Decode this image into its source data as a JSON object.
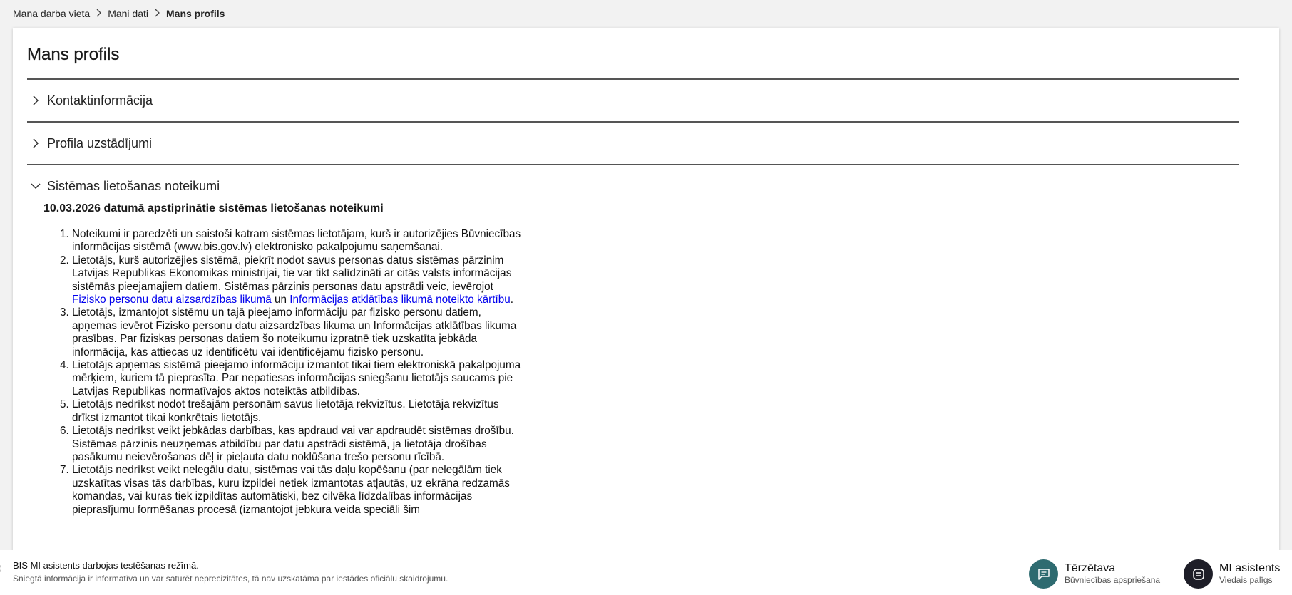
{
  "breadcrumb": {
    "items": [
      "Mana darba vieta",
      "Mani dati"
    ],
    "current": "Mans profils"
  },
  "page": {
    "title": "Mans profils"
  },
  "sections": [
    {
      "label": "Kontaktinformācija",
      "expanded": false
    },
    {
      "label": "Profila uzstādījumi",
      "expanded": false
    },
    {
      "label": "Sistēmas lietošanas noteikumi",
      "expanded": true
    }
  ],
  "terms": {
    "title": "10.03.2026 datumā apstiprinātie sistēmas lietošanas noteikumi",
    "items": [
      "Noteikumi ir paredzēti un saistoši katram sistēmas lietotājam, kurš ir autorizējies Būvniecības informācijas sistēmā (www.bis.gov.lv) elektronisko pakalpojumu saņemšanai.",
      {
        "before": "Lietotājs, kurš autorizējies sistēmā, piekrīt nodot savus personas datus sistēmas pārzinim Latvijas Republikas Ekonomikas ministrijai, tie var tikt salīdzināti ar citās valsts informācijas sistēmās pieejamajiem datiem. Sistēmas pārzinis personas datu apstrādi veic, ievērojot",
        "link1": " Fizisko personu datu aizsardzības likumā",
        "middle": " un ",
        "link2": "Informācijas atklātības likumā noteikto kārtību",
        "after": "."
      },
      "Lietotājs, izmantojot sistēmu un tajā pieejamo informāciju par fizisko personu datiem, apņemas ievērot Fizisko personu datu aizsardzības likuma un Informācijas atklātības likuma prasības. Par fiziskas personas datiem šo noteikumu izpratnē tiek uzskatīta jebkāda informācija, kas attiecas uz identificētu vai identificējamu fizisko personu.",
      "Lietotājs apņemas sistēmā pieejamo informāciju izmantot tikai tiem elektroniskā pakalpojuma mērķiem, kuriem tā pieprasīta. Par nepatiesas informācijas sniegšanu lietotājs saucams pie Latvijas Republikas normatīvajos aktos noteiktās atbildības.",
      "Lietotājs nedrīkst nodot trešajām personām savus lietotāja rekvizītus. Lietotāja rekvizītus drīkst izmantot tikai konkrētais lietotājs.",
      "Lietotājs nedrīkst veikt jebkādas darbības, kas apdraud vai var apdraudēt sistēmas drošību. Sistēmas pārzinis neuzņemas atbildību par datu apstrādi sistēmā, ja lietotāja drošības pasākumu neievērošanas dēļ ir pieļauta datu noklūšana trešo personu rīcībā.",
      "Lietotājs nedrīkst veikt nelegālu datu, sistēmas vai tās daļu kopēšanu (par nelegālām tiek uzskatītas visas tās darbības, kuru izpildei netiek izmantotas atļautās, uz ekrāna redzamās komandas, vai kuras tiek izpildītas automātiski, bez cilvēka līdzdalības informācijas pieprasījumu formēšanas procesā (izmantojot jebkura veida speciāli šim"
    ]
  },
  "footer": {
    "notice_title": "BIS MI asistents darbojas testēšanas režīmā.",
    "notice_sub": "Sniegtā informācija ir informatīva un var saturēt neprecizitātes, tā nav uzskatāma par iestādes oficiālu skaidrojumu.",
    "chat": {
      "label": "Tērzētava",
      "sublabel": "Būvniecības apspriešana",
      "color": "#2e6b70"
    },
    "ai": {
      "label": "MI asistents",
      "sublabel": "Viedais palīgs",
      "color": "#1e1e28"
    }
  }
}
